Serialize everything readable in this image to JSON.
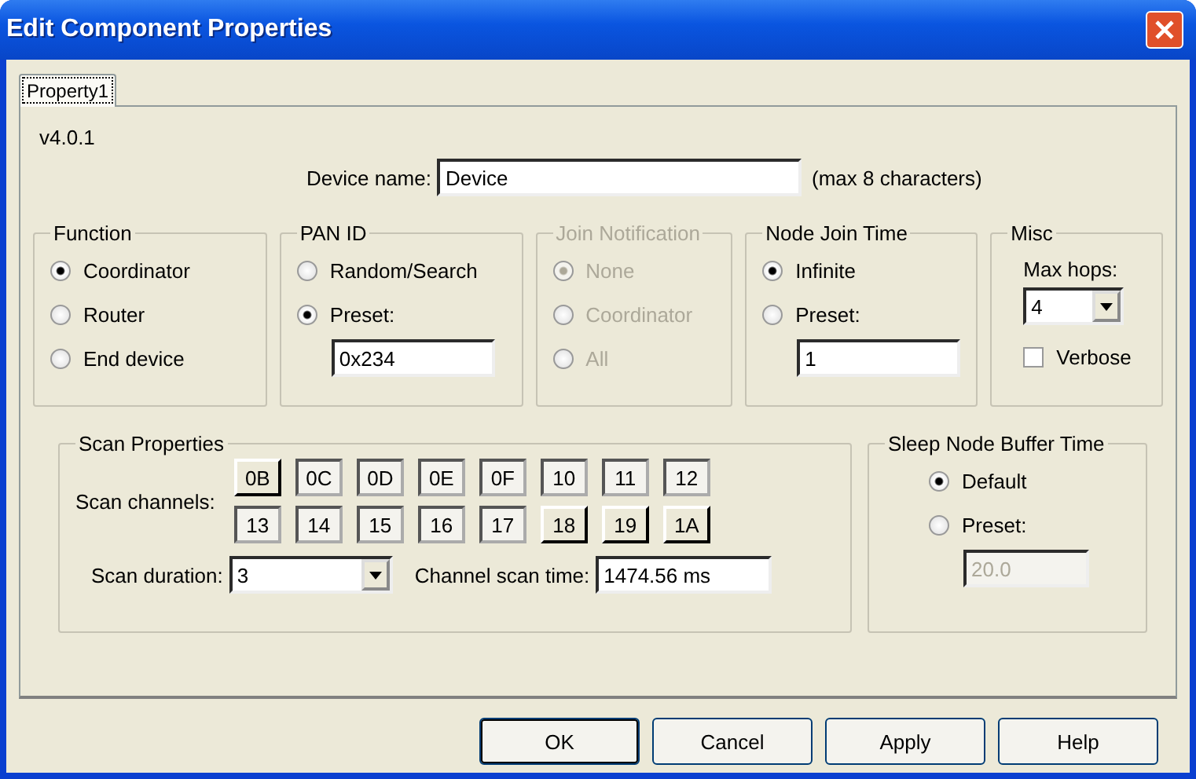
{
  "window": {
    "title": "Edit Component Properties"
  },
  "tabs": [
    {
      "label": "Property1",
      "selected": true
    }
  ],
  "version": "v4.0.1",
  "device_name": {
    "label": "Device name:",
    "value": "Device",
    "hint": "(max 8 characters)"
  },
  "groups": [
    {
      "kind": "radio",
      "title": "Function",
      "disabled": false,
      "options": [
        {
          "label": "Coordinator",
          "selected": true
        },
        {
          "label": "Router",
          "selected": false
        },
        {
          "label": "End device",
          "selected": false
        }
      ]
    },
    {
      "kind": "radio",
      "title": "PAN ID",
      "disabled": false,
      "options": [
        {
          "label": "Random/Search",
          "selected": false
        },
        {
          "label": "Preset:",
          "selected": true
        }
      ],
      "field": {
        "value": "0x234",
        "disabled": false
      }
    },
    {
      "kind": "radio",
      "title": "Join Notification",
      "disabled": true,
      "options": [
        {
          "label": "None",
          "selected": true
        },
        {
          "label": "Coordinator",
          "selected": false
        },
        {
          "label": "All",
          "selected": false
        }
      ]
    },
    {
      "kind": "radio",
      "title": "Node Join Time",
      "disabled": false,
      "options": [
        {
          "label": "Infinite",
          "selected": true
        },
        {
          "label": "Preset:",
          "selected": false
        }
      ],
      "field": {
        "value": "1",
        "disabled": false
      }
    },
    {
      "kind": "misc",
      "title": "Misc",
      "label": "Max hops:",
      "value": "4",
      "checkbox": {
        "label": "Verbose",
        "checked": false
      }
    }
  ],
  "scan": {
    "title": "Scan Properties",
    "channels_label": "Scan channels:",
    "channels": [
      {
        "label": "0B",
        "pressed": false
      },
      {
        "label": "0C",
        "pressed": true
      },
      {
        "label": "0D",
        "pressed": true
      },
      {
        "label": "0E",
        "pressed": true
      },
      {
        "label": "0F",
        "pressed": true
      },
      {
        "label": "10",
        "pressed": true
      },
      {
        "label": "11",
        "pressed": true
      },
      {
        "label": "12",
        "pressed": true
      },
      {
        "label": "13",
        "pressed": true
      },
      {
        "label": "14",
        "pressed": true
      },
      {
        "label": "15",
        "pressed": true
      },
      {
        "label": "16",
        "pressed": true
      },
      {
        "label": "17",
        "pressed": true
      },
      {
        "label": "18",
        "pressed": false
      },
      {
        "label": "19",
        "pressed": false
      },
      {
        "label": "1A",
        "pressed": false
      }
    ],
    "duration": {
      "label": "Scan duration:",
      "value": "3"
    },
    "scan_time": {
      "label": "Channel scan time:",
      "value": "1474.56 ms"
    }
  },
  "sleep": {
    "title": "Sleep Node Buffer Time",
    "options": [
      {
        "label": "Default",
        "selected": true
      },
      {
        "label": "Preset:",
        "selected": false
      }
    ],
    "field": {
      "value": "20.0",
      "disabled": true
    }
  },
  "buttons": [
    {
      "label": "OK",
      "default": true
    },
    {
      "label": "Cancel",
      "default": false
    },
    {
      "label": "Apply",
      "default": false
    },
    {
      "label": "Help",
      "default": false
    }
  ]
}
